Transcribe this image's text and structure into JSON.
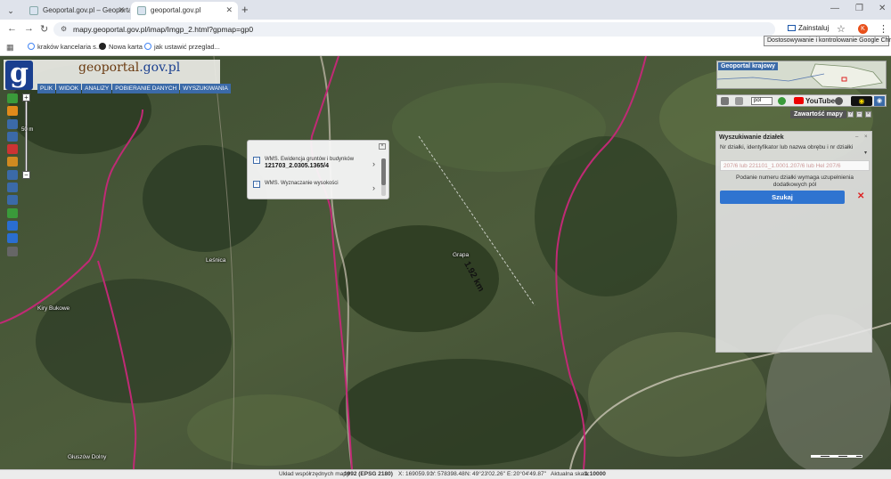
{
  "browser": {
    "tabs": [
      {
        "label": "Geoportal.gov.pl – Geoportal kr"
      },
      {
        "label": "geoportal.gov.pl"
      }
    ],
    "url": "mapy.geoportal.gov.pl/imap/Imgp_2.html?gpmap=gp0",
    "install_label": "Zainstaluj",
    "profile_initial": "K",
    "tooltip": "Dostosowywanie i kontrolowanie Google Chrome",
    "bookmarks": [
      {
        "label": "kraków kancelaria s..."
      },
      {
        "label": "Nowa karta"
      },
      {
        "label": "jak ustawić przeglad..."
      }
    ]
  },
  "geoportal": {
    "logo_letter": "g",
    "logo_prefix": "geo",
    "logo_mid": "portal",
    "logo_suffix": ".gov.pl",
    "menu": [
      "PLIK",
      "WIDOK",
      "ANALIZY",
      "POBIERANIE DANYCH",
      "WYSZUKIWANIA"
    ],
    "scale_label": "50 m",
    "tool_colors": [
      "#3a9a3a",
      "#e08a1a",
      "#3b6aa8",
      "#3b6aa8",
      "#c33",
      "#d08a20",
      "#3b6aa8",
      "#3b6aa8",
      "#3b6aa8",
      "#3a9a3a",
      "#2a6ed0",
      "#2a6ed0",
      "#666"
    ]
  },
  "popup": {
    "items": [
      {
        "label": "WMS. Ewidencja gruntów i budynków",
        "value": "121703_2.0305.1365/4"
      },
      {
        "label": "WMS. Wyznaczanie wysokości",
        "value": ""
      }
    ]
  },
  "map_labels": [
    {
      "text": "Leśnica"
    },
    {
      "text": "Kiry Bukowe"
    },
    {
      "text": "Grapa"
    },
    {
      "text": "Głuszów Dolny"
    }
  ],
  "measurement": "1.92 km",
  "right_panel": {
    "overview_title": "Geoportal krajowy",
    "language": "pol",
    "youtube": "YouTube",
    "content_tab": "Zawartość mapy",
    "search_title": "Wyszukiwanie działek",
    "search_hint": "Nr działki, identyfikator lub nazwa obrębu i nr działki",
    "search_placeholder": "207/6 lub 221101_1.0001.207/6 lub Hel 207/6",
    "search_note": "Podanie numeru działki wymaga uzupełnienia dodatkowych pól",
    "search_button": "Szukaj"
  },
  "status": {
    "left": "",
    "crs_label": "Układ współrzędnych mapy",
    "crs_value": "1992 (EPSG 2180)",
    "x_label": "X:",
    "x_value": "169059.91",
    "y_label": "Y:",
    "y_value": "578398.48",
    "n_label": "N:",
    "n_value": "49°23'02.26\"",
    "e_label": "E:",
    "e_value": "20°04'49.87\"",
    "scale_label": "Aktualna skala",
    "scale_value": "1:10000"
  }
}
